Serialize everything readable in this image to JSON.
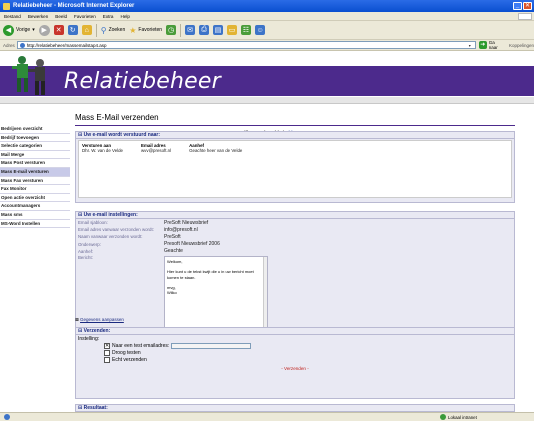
{
  "window": {
    "title": "Relatiebeheer - Microsoft Internet Explorer",
    "min": "_",
    "max": "□",
    "close": "✕"
  },
  "menu": [
    "Bestand",
    "Bewerken",
    "Beeld",
    "Favorieten",
    "Extra",
    "Help"
  ],
  "toolbar": {
    "back": "Vorige",
    "search": "Zoeken",
    "favorites": "Favorieten"
  },
  "address": {
    "label": "Adres",
    "url": "http://relatiebeheer/massemailstap4.asp",
    "go": "Ga naar",
    "links": "Koppelingen"
  },
  "banner": {
    "title": "Relatiebeheer"
  },
  "user": {
    "name": "Wilko van de Velde",
    "separator": "|",
    "logout": "Uitloggen"
  },
  "page_title": "Mass E-Mail verzenden",
  "sidebar": {
    "items": [
      {
        "label": "Bedrijven overzicht",
        "active": false
      },
      {
        "label": "Bedrijf toevoegen",
        "active": false
      },
      {
        "label": "Selectie categorien",
        "active": false
      },
      {
        "label": "Mail Merge",
        "active": false
      },
      {
        "label": "Mass Post versturen",
        "active": false
      },
      {
        "label": "Mass E-mail versturen",
        "active": true
      },
      {
        "label": "Mass Fax versturen",
        "active": false
      },
      {
        "label": "Fax Monitor",
        "active": false
      },
      {
        "label": "Open actie overzicht",
        "active": false
      },
      {
        "label": "Accountmanagers",
        "active": false
      },
      {
        "label": "Mass sms",
        "active": false
      },
      {
        "label": "MS-Word Instellen",
        "active": false
      }
    ]
  },
  "recipients": {
    "heading": "Uw e-mail wordt verstuurd naar:",
    "columns": [
      "Versturen aan",
      "Email adres",
      "Aanhef"
    ],
    "rows": [
      [
        "Dhr. W. van de Velde",
        "wvv@presoft.nl",
        "Geachte heer van de Velde"
      ]
    ]
  },
  "settings": {
    "heading": "Uw e-mail instellingen:",
    "rows": [
      {
        "label": "Email sjabloon:",
        "value": "PreSoft Nieuwsbrief"
      },
      {
        "label": "Email adres vanwaar verzonden wordt:",
        "value": "info@presoft.nl"
      },
      {
        "label": "Naam vanwaar verzonden wordt:",
        "value": "PreSoft"
      },
      {
        "label": "Onderwerp:",
        "value": "Presoft Nieuwsbrief 2006"
      },
      {
        "label": "Aanhef:",
        "value": "Geachte"
      }
    ],
    "bericht_label": "Bericht:",
    "bericht_lines": [
      "Welkom,",
      "",
      "Hier kunt u de tekst kwijt die u in uw bericht moet komen te staan.",
      "",
      "mvg,",
      "Wilko"
    ]
  },
  "edit_link": "Gegevens aanpassen",
  "send": {
    "heading": "Verzenden:",
    "instelling": "Instelling:",
    "options": [
      {
        "label": "Naar een test emailadres:",
        "checked": true
      },
      {
        "label": "Droog testen",
        "checked": false
      },
      {
        "label": "Echt verzenden",
        "checked": false
      }
    ],
    "button": "- Verzenden -"
  },
  "result": {
    "heading": "Resultaat:"
  },
  "status": {
    "zone": "Lokaal intranet"
  }
}
